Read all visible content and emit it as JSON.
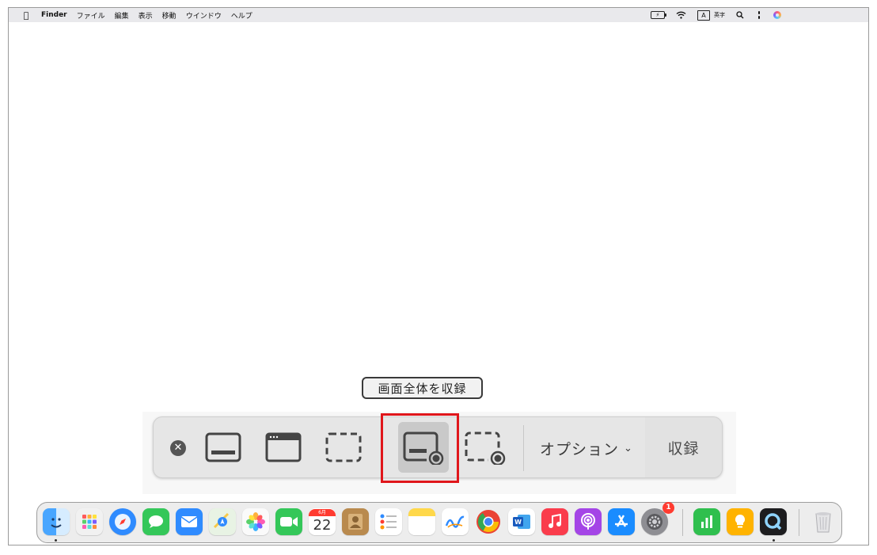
{
  "menubar": {
    "apple": "",
    "app_name": "Finder",
    "items": [
      "ファイル",
      "編集",
      "表示",
      "移動",
      "ウインドウ",
      "ヘルプ"
    ],
    "input_mode_box": "A",
    "input_mode_label": "英字"
  },
  "tooltip": {
    "text": "画面全体を収録"
  },
  "toolbar": {
    "buttons": [
      {
        "name": "close-button",
        "icon": "close-icon"
      },
      {
        "name": "capture-entire-screen",
        "icon": "screen-icon"
      },
      {
        "name": "capture-window",
        "icon": "window-icon"
      },
      {
        "name": "capture-selection",
        "icon": "selection-icon"
      },
      {
        "name": "record-entire-screen",
        "icon": "screen-record-icon",
        "selected": true
      },
      {
        "name": "record-selection",
        "icon": "selection-record-icon"
      }
    ],
    "options_label": "オプション",
    "record_label": "収録",
    "highlight_color": "#e0161b"
  },
  "dock": {
    "apps": [
      {
        "name": "Finder",
        "icon": "finder-icon",
        "running": true
      },
      {
        "name": "Launchpad",
        "icon": "launchpad-icon"
      },
      {
        "name": "Safari",
        "icon": "safari-icon"
      },
      {
        "name": "Messages",
        "icon": "messages-icon"
      },
      {
        "name": "Mail",
        "icon": "mail-icon"
      },
      {
        "name": "Maps",
        "icon": "maps-icon"
      },
      {
        "name": "Photos",
        "icon": "photos-icon"
      },
      {
        "name": "FaceTime",
        "icon": "facetime-icon"
      },
      {
        "name": "Calendar",
        "icon": "calendar-icon",
        "month": "6月",
        "day": "22"
      },
      {
        "name": "Contacts",
        "icon": "contacts-icon"
      },
      {
        "name": "Reminders",
        "icon": "reminders-icon"
      },
      {
        "name": "Notes",
        "icon": "notes-icon"
      },
      {
        "name": "Freeform",
        "icon": "freeform-icon"
      },
      {
        "name": "Chrome",
        "icon": "chrome-icon"
      },
      {
        "name": "Word",
        "icon": "word-icon"
      },
      {
        "name": "Music",
        "icon": "music-icon"
      },
      {
        "name": "Podcasts",
        "icon": "podcasts-icon"
      },
      {
        "name": "App Store",
        "icon": "appstore-icon"
      },
      {
        "name": "System Settings",
        "icon": "settings-icon",
        "badge": "1"
      },
      {
        "name": "Numbers",
        "icon": "numbers-icon"
      },
      {
        "name": "Tips",
        "icon": "tips-icon"
      },
      {
        "name": "QuickTime Player",
        "icon": "quicktime-icon",
        "running": true
      },
      {
        "name": "Trash",
        "icon": "trash-icon"
      }
    ]
  }
}
